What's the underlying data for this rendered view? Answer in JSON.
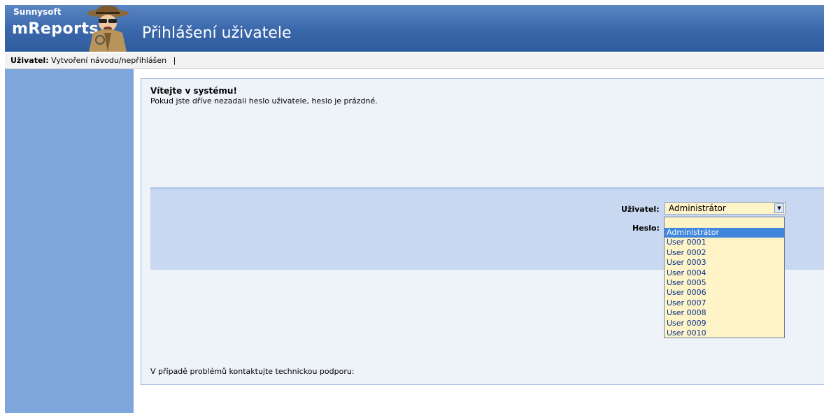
{
  "header": {
    "brand_small": "Sunnysoft",
    "brand_main": "mReports",
    "title": "Přihlášení uživatele"
  },
  "userbar": {
    "label": "Uživatel:",
    "value": "Vytvoření návodu/nepřihlášen",
    "separator": "|"
  },
  "main": {
    "welcome_title": "Vítejte v systému!",
    "welcome_text": "Pokud jste dříve nezadali heslo uživatele, heslo je prázdné.",
    "support_text": "V případě problémů kontaktujte technickou podporu:"
  },
  "login": {
    "user_label": "Uživatel:",
    "password_label": "Heslo:",
    "selected_user": "Administrátor",
    "options": [
      "Administrátor",
      "User 0001",
      "User 0002",
      "User 0003",
      "User 0004",
      "User 0005",
      "User 0006",
      "User 0007",
      "User 0008",
      "User 0009",
      "User 0010"
    ]
  },
  "icons": {
    "dropdown": "chevron-down-icon",
    "mascot": "detective-mascot-icon"
  },
  "colors": {
    "header": "#3a67aa",
    "sidebar": "#7ea6dc",
    "panel": "#eef3fa",
    "login_band": "#c8d8f0",
    "select_bg": "#fff3c8",
    "selected_option": "#3f86dc"
  }
}
